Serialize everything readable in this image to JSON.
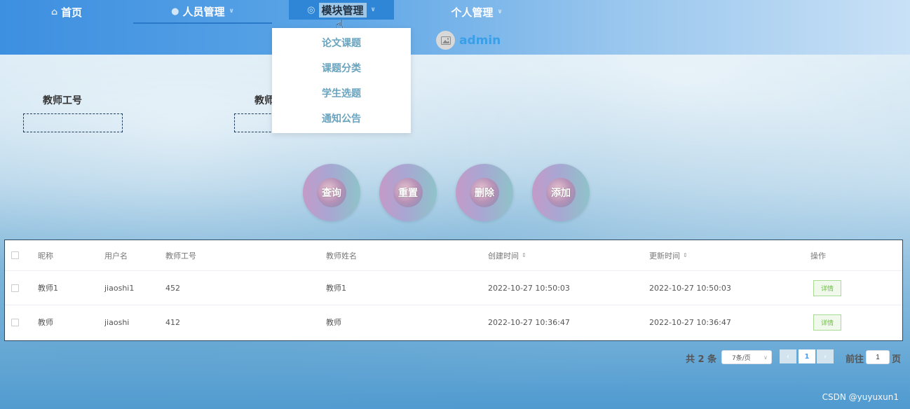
{
  "nav": {
    "home": "首页",
    "person": "人员管理",
    "module": "模块管理",
    "personal": "个人管理"
  },
  "user": {
    "name": "admin"
  },
  "dropdown": {
    "items": [
      "论文课题",
      "课题分类",
      "学生选题",
      "通知公告"
    ]
  },
  "search": {
    "teacher_no_label": "教师工号",
    "teacher_no_value": "",
    "teacher_name_label": "教师",
    "teacher_name_value": ""
  },
  "buttons": {
    "query": "查询",
    "reset": "重置",
    "delete": "删除",
    "add": "添加"
  },
  "table": {
    "headers": {
      "nickname": "昵称",
      "username": "用户名",
      "teacher_no": "教师工号",
      "teacher_name": "教师姓名",
      "created": "创建时间",
      "updated": "更新时间",
      "action": "操作"
    },
    "sort_icon": "⇕",
    "rows": [
      {
        "nickname": "教师1",
        "username": "jiaoshi1",
        "teacher_no": "452",
        "teacher_name": "教师1",
        "created": "2022-10-27 10:50:03",
        "updated": "2022-10-27 10:50:03",
        "action": "详情"
      },
      {
        "nickname": "教师",
        "username": "jiaoshi",
        "teacher_no": "412",
        "teacher_name": "教师",
        "created": "2022-10-27 10:36:47",
        "updated": "2022-10-27 10:36:47",
        "action": "详情"
      }
    ]
  },
  "pagination": {
    "total": "共 2 条",
    "page_size": "7条/页",
    "current_page": "1",
    "goto_label": "前往",
    "goto_value": "1",
    "page_word": "页"
  },
  "watermark": "CSDN @yuyuxun1",
  "colors": {
    "nav_active": "#2f86d6",
    "accent": "#3a9fe6",
    "success": "#67c23a"
  }
}
